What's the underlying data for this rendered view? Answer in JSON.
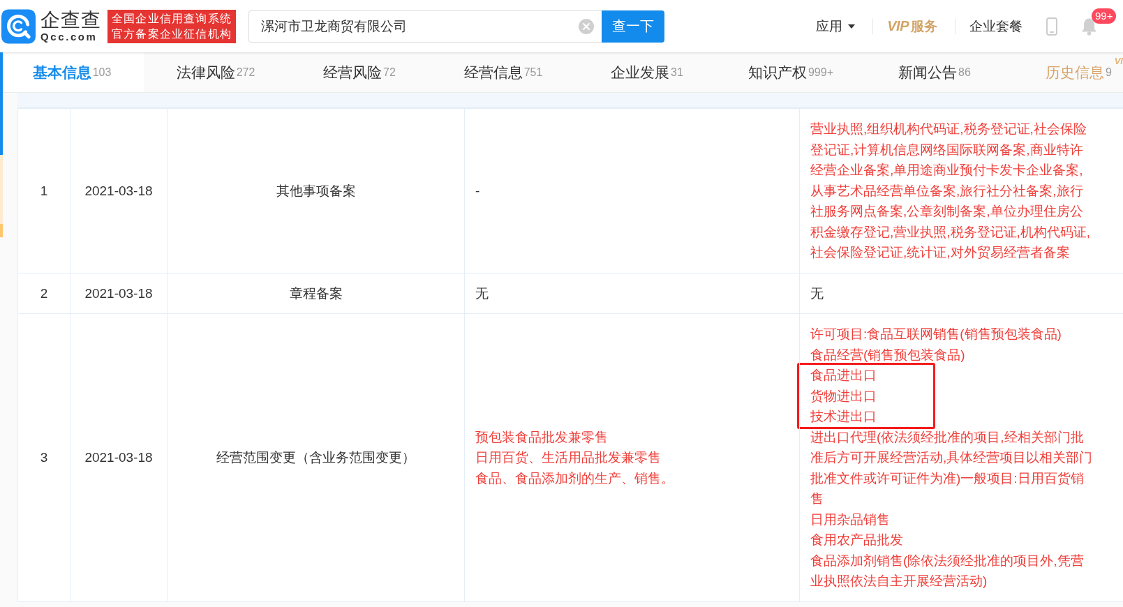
{
  "header": {
    "logo": {
      "name": "企查查",
      "domain": "Qcc.com"
    },
    "badge_lines": [
      "全国企业信用查询系统",
      "官方备案企业征信机构"
    ],
    "search": {
      "value": "漯河市卫龙商贸有限公司",
      "button": "查一下"
    },
    "nav": [
      {
        "kind": "menu",
        "label": "应用"
      },
      {
        "kind": "vip",
        "mark": "VIP",
        "label": "服务"
      },
      {
        "kind": "link",
        "label": "企业套餐"
      }
    ],
    "notifications": {
      "badge": "99+"
    }
  },
  "tabs": [
    {
      "label": "基本信息",
      "count": "103",
      "selected": true,
      "kind": "normal"
    },
    {
      "label": "法律风险",
      "count": "272",
      "selected": false,
      "kind": "normal"
    },
    {
      "label": "经营风险",
      "count": "72",
      "selected": false,
      "kind": "normal"
    },
    {
      "label": "经营信息",
      "count": "751",
      "selected": false,
      "kind": "normal"
    },
    {
      "label": "企业发展",
      "count": "31",
      "selected": false,
      "kind": "normal"
    },
    {
      "label": "知识产权",
      "count": "999+",
      "selected": false,
      "kind": "normal"
    },
    {
      "label": "新闻公告",
      "count": "86",
      "selected": false,
      "kind": "normal"
    },
    {
      "label": "历史信息",
      "count": "9",
      "selected": false,
      "kind": "vip",
      "tag": "VI"
    }
  ],
  "table": {
    "rows": [
      {
        "cells": [
          {
            "kind": "text",
            "text": "1"
          },
          {
            "kind": "text",
            "text": "2021-03-18"
          },
          {
            "kind": "text",
            "text": "其他事项备案"
          },
          {
            "kind": "text",
            "text": "-",
            "changed": false
          },
          {
            "kind": "text",
            "text": "营业执照,组织机构代码证,税务登记证,社会保险登记证,计算机信息网络国际联网备案,商业特许经营企业备案,单用途商业预付卡发卡企业备案,从事艺术品经营单位备案,旅行社分社备案,旅行社服务网点备案,公章刻制备案,单位办理住房公积金缴存登记,营业执照,税务登记证,机构代码证,社会保险登记证,统计证,对外贸易经营者备案",
            "changed": true
          }
        ]
      },
      {
        "cells": [
          {
            "kind": "text",
            "text": "2"
          },
          {
            "kind": "text",
            "text": "2021-03-18"
          },
          {
            "kind": "text",
            "text": "章程备案"
          },
          {
            "kind": "text",
            "text": "无",
            "changed": false
          },
          {
            "kind": "text",
            "text": "无",
            "changed": false
          }
        ]
      },
      {
        "cells": [
          {
            "kind": "text",
            "text": "3"
          },
          {
            "kind": "text",
            "text": "2021-03-18"
          },
          {
            "kind": "text",
            "text": "经营范围变更（含业务范围变更）"
          },
          {
            "kind": "list",
            "changed": true,
            "items": [
              {
                "text": "预包装食品批发兼零售",
                "highlighted": false
              },
              {
                "text": "日用百货、生活用品批发兼零售",
                "highlighted": false
              },
              {
                "text": "食品、食品添加剂的生产、销售。",
                "highlighted": false
              }
            ]
          },
          {
            "kind": "list",
            "changed": true,
            "items": [
              {
                "text": "许可项目:食品互联网销售(销售预包装食品)",
                "highlighted": false
              },
              {
                "text": "食品经营(销售预包装食品)",
                "highlighted": false
              },
              {
                "text": "食品进出口",
                "highlighted": true
              },
              {
                "text": "货物进出口",
                "highlighted": true
              },
              {
                "text": "技术进出口",
                "highlighted": true
              },
              {
                "text": "进出口代理(依法须经批准的项目,经相关部门批准后方可开展经营活动,具体经营项目以相关部门批准文件或许可证件为准)一般项目:日用百货销售",
                "highlighted": false
              },
              {
                "text": "日用杂品销售",
                "highlighted": false
              },
              {
                "text": "食用农产品批发",
                "highlighted": false
              },
              {
                "text": "食品添加剂销售(除依法须经批准的项目外,凭营业执照依法自主开展经营活动)",
                "highlighted": false
              }
            ]
          }
        ]
      }
    ]
  }
}
